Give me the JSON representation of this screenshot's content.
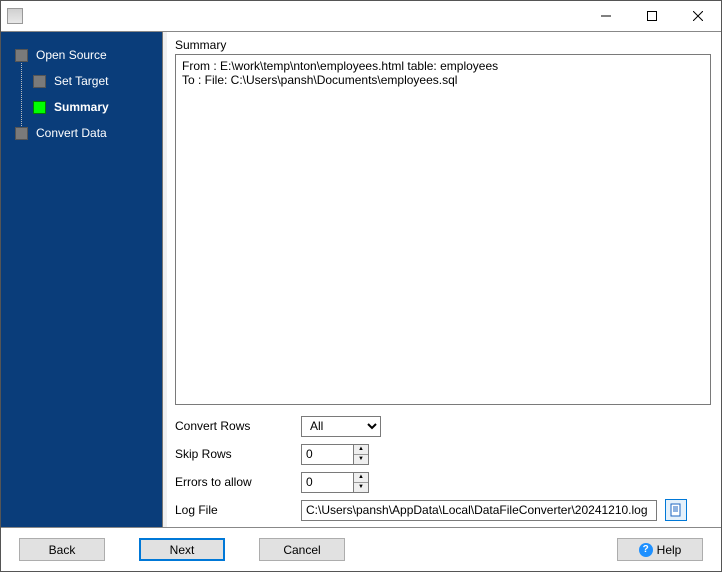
{
  "titlebar": {
    "title": ""
  },
  "sidebar": {
    "steps": [
      {
        "label": "Open Source",
        "active": false,
        "indent": 0
      },
      {
        "label": "Set Target",
        "active": false,
        "indent": 1
      },
      {
        "label": "Summary",
        "active": true,
        "indent": 1
      },
      {
        "label": "Convert Data",
        "active": false,
        "indent": 0
      }
    ]
  },
  "main": {
    "summary_label": "Summary",
    "summary_text": "From : E:\\work\\temp\\nton\\employees.html table: employees\nTo : File: C:\\Users\\pansh\\Documents\\employees.sql",
    "convert_rows_label": "Convert Rows",
    "convert_rows_value": "All",
    "skip_rows_label": "Skip Rows",
    "skip_rows_value": "0",
    "errors_label": "Errors to allow",
    "errors_value": "0",
    "logfile_label": "Log File",
    "logfile_value": "C:\\Users\\pansh\\AppData\\Local\\DataFileConverter\\20241210.log"
  },
  "footer": {
    "back": "Back",
    "next": "Next",
    "cancel": "Cancel",
    "help": "Help"
  }
}
